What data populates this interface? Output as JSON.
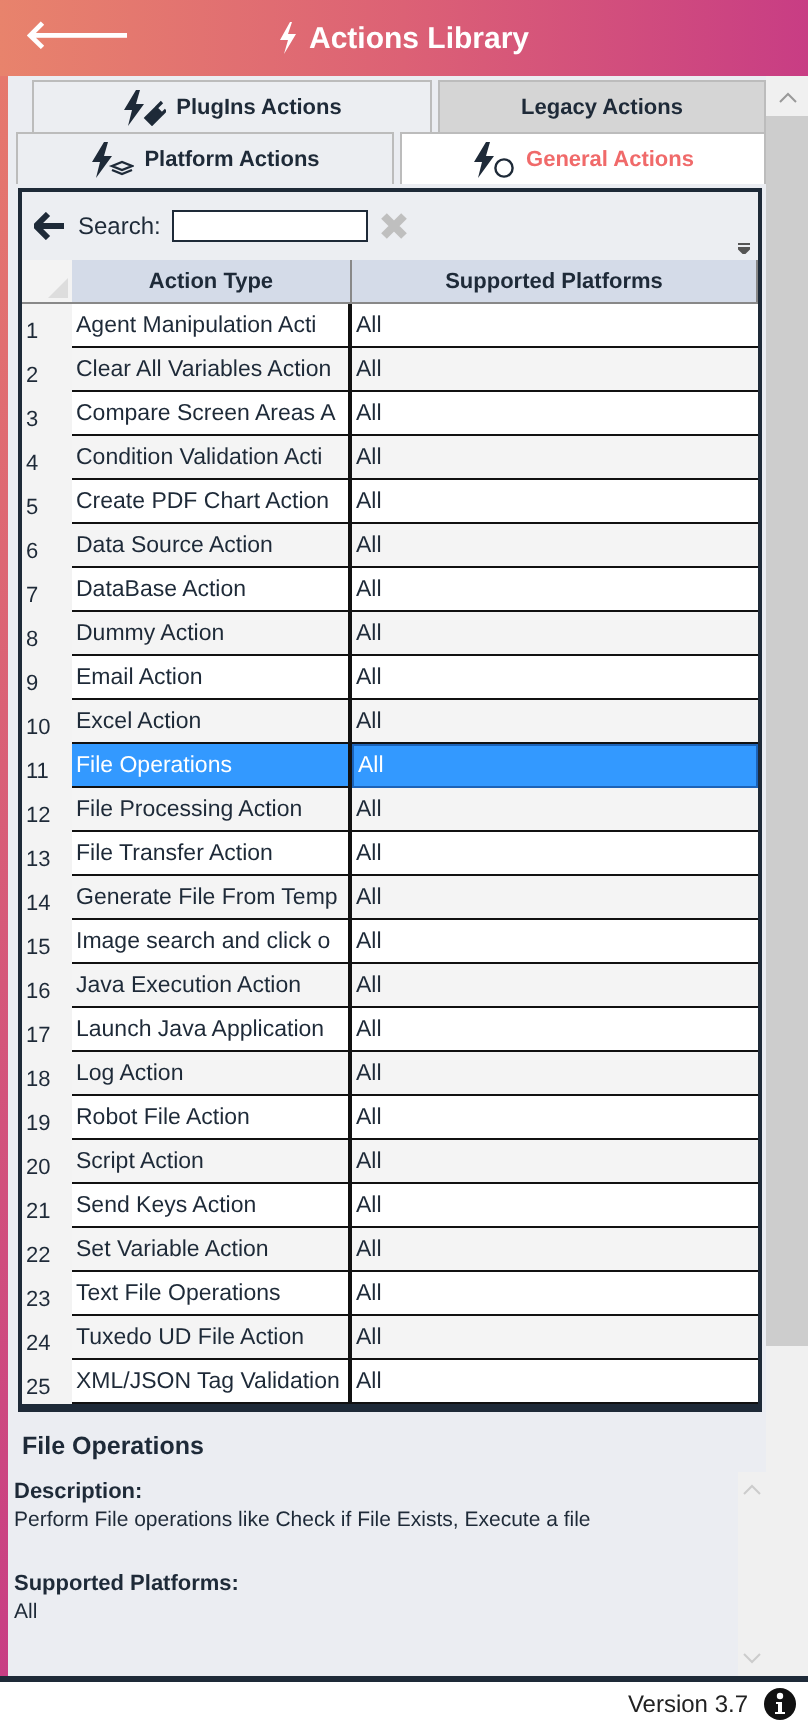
{
  "header": {
    "back": "🡐",
    "title": "Actions Library"
  },
  "tabs": [
    {
      "label": "PlugIns Actions",
      "selected": false
    },
    {
      "label": "Legacy Actions",
      "selected": false
    },
    {
      "label": "Platform Actions",
      "selected": false
    },
    {
      "label": "General Actions",
      "selected": true
    }
  ],
  "search": {
    "label": "Search:"
  },
  "table": {
    "columns": [
      "Action Type",
      "Supported Platforms"
    ],
    "rows": [
      {
        "num": "1",
        "action": "Agent Manipulation Acti",
        "platforms": "All",
        "selected": false
      },
      {
        "num": "2",
        "action": "Clear All Variables Action",
        "platforms": "All",
        "selected": false
      },
      {
        "num": "3",
        "action": "Compare Screen Areas A",
        "platforms": "All",
        "selected": false
      },
      {
        "num": "4",
        "action": "Condition Validation Acti",
        "platforms": "All",
        "selected": false
      },
      {
        "num": "5",
        "action": "Create PDF Chart Action",
        "platforms": "All",
        "selected": false
      },
      {
        "num": "6",
        "action": "Data Source Action",
        "platforms": "All",
        "selected": false
      },
      {
        "num": "7",
        "action": "DataBase Action",
        "platforms": "All",
        "selected": false
      },
      {
        "num": "8",
        "action": "Dummy Action",
        "platforms": "All",
        "selected": false
      },
      {
        "num": "9",
        "action": "Email Action",
        "platforms": "All",
        "selected": false
      },
      {
        "num": "10",
        "action": "Excel Action",
        "platforms": "All",
        "selected": false
      },
      {
        "num": "11",
        "action": "File Operations",
        "platforms": "All",
        "selected": true
      },
      {
        "num": "12",
        "action": "File Processing Action",
        "platforms": "All",
        "selected": false
      },
      {
        "num": "13",
        "action": "File Transfer Action",
        "platforms": "All",
        "selected": false
      },
      {
        "num": "14",
        "action": "Generate File From Temp",
        "platforms": "All",
        "selected": false
      },
      {
        "num": "15",
        "action": "Image search and click o",
        "platforms": "All",
        "selected": false
      },
      {
        "num": "16",
        "action": "Java Execution Action",
        "platforms": "All",
        "selected": false
      },
      {
        "num": "17",
        "action": "Launch Java Application",
        "platforms": "All",
        "selected": false
      },
      {
        "num": "18",
        "action": "Log Action",
        "platforms": "All",
        "selected": false
      },
      {
        "num": "19",
        "action": "Robot File Action",
        "platforms": "All",
        "selected": false
      },
      {
        "num": "20",
        "action": "Script Action",
        "platforms": "All",
        "selected": false
      },
      {
        "num": "21",
        "action": "Send Keys Action",
        "platforms": "All",
        "selected": false
      },
      {
        "num": "22",
        "action": "Set Variable Action",
        "platforms": "All",
        "selected": false
      },
      {
        "num": "23",
        "action": "Text File Operations",
        "platforms": "All",
        "selected": false
      },
      {
        "num": "24",
        "action": "Tuxedo UD File Action",
        "platforms": "All",
        "selected": false
      },
      {
        "num": "25",
        "action": "XML/JSON Tag Validation",
        "platforms": "All",
        "selected": false
      }
    ]
  },
  "details": {
    "title": "File Operations",
    "description_label": "Description:",
    "description": "Perform File operations like Check if File Exists, Execute a file",
    "platforms_label": "Supported Platforms:",
    "platforms": "All"
  },
  "footer": {
    "version": "Version 3.7"
  }
}
